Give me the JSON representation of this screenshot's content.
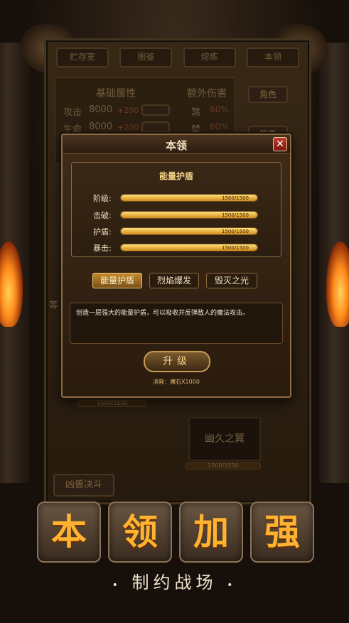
{
  "background": {
    "tabs": [
      "贮存室",
      "图鉴",
      "熔炼",
      "本领"
    ],
    "base_attr_title": "基础属性",
    "extra_dmg_title": "额外伤害",
    "stats": [
      {
        "label": "攻击",
        "value": "8000",
        "bonus": "+200"
      },
      {
        "label": "生命",
        "value": "8000",
        "bonus": "+200"
      }
    ],
    "extra": [
      {
        "label": "煞",
        "value": "60%"
      },
      {
        "label": "焚",
        "value": "60%"
      }
    ],
    "side_buttons": [
      "角色",
      "器具"
    ],
    "left_cut_text": "等",
    "small_bar_1": "1500/1500",
    "wing_label": "幽久之翼",
    "small_bar_2": "1500/1500",
    "bottom_left_label": "凶兽决斗"
  },
  "modal": {
    "title": "本领",
    "close_label": "✕",
    "stats_title": "能量护盾",
    "stats": [
      {
        "label": "阶级:",
        "value": "1500/1500",
        "fill": 1.0
      },
      {
        "label": "击破:",
        "value": "1500/1500",
        "fill": 1.0
      },
      {
        "label": "护盾:",
        "value": "1500/1500",
        "fill": 1.0
      },
      {
        "label": "暴击:",
        "value": "1500/1500",
        "fill": 1.0
      }
    ],
    "skill_tabs": [
      {
        "label": "能量护盾",
        "active": true
      },
      {
        "label": "烈焰爆发",
        "active": false
      },
      {
        "label": "毁灭之光",
        "active": false
      }
    ],
    "description": "创造一层强大的能量护盾，可以吸收并反弹敌人的魔法攻击。",
    "upgrade_label": "升级",
    "cost": "消耗：魔石X1000"
  },
  "banner": {
    "tiles": [
      "本",
      "领",
      "加",
      "强"
    ],
    "slogan": "制约战场",
    "dot": "•"
  }
}
